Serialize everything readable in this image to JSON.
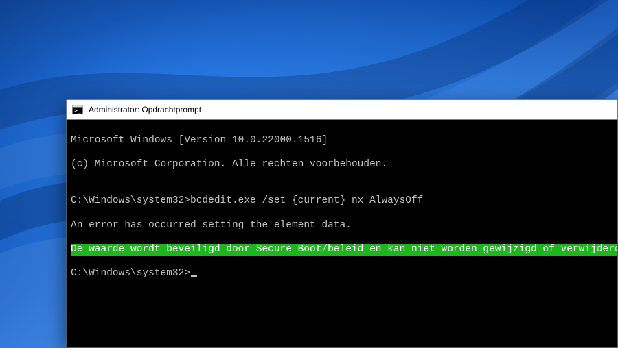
{
  "window": {
    "title": "Administrator: Opdrachtprompt"
  },
  "terminal": {
    "line1": "Microsoft Windows [Version 10.0.22000.1516]",
    "line2": "(c) Microsoft Corporation. Alle rechten voorbehouden.",
    "blank1": "",
    "cmd_prompt1": "C:\\Windows\\system32>",
    "cmd1": "bcdedit.exe /set {current} nx AlwaysOff",
    "err1": "An error has occurred setting the element data.",
    "err2": "De waarde wordt beveiligd door Secure Boot/beleid en kan niet worden gewijzigd of verwijderd.",
    "blank2": "",
    "cmd_prompt2": "C:\\Windows\\system32>"
  },
  "icons": {
    "terminal_icon": "terminal-icon"
  },
  "colors": {
    "highlight_bg": "#1db61d",
    "terminal_bg": "#000000",
    "terminal_fg": "#c0c0c0",
    "titlebar_bg": "#ffffff"
  }
}
